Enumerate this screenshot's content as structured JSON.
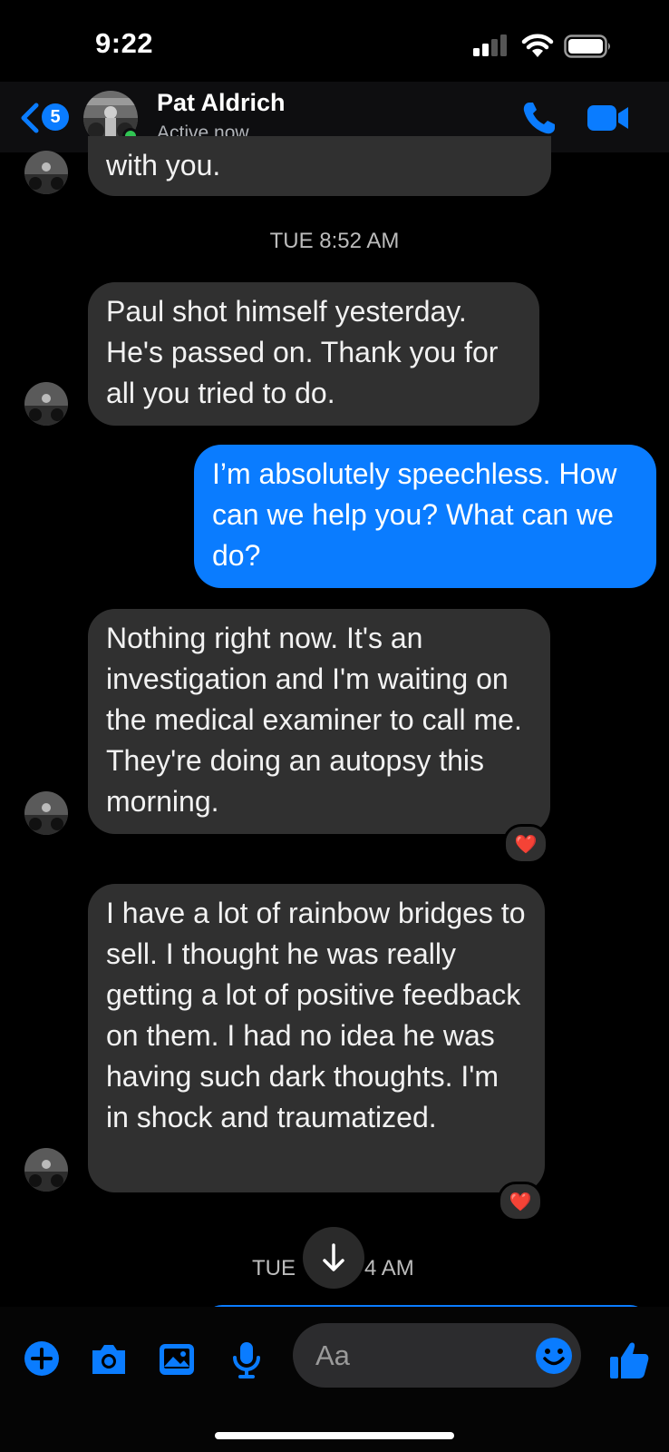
{
  "status_bar": {
    "time": "9:22"
  },
  "header": {
    "back_badge_count": "5",
    "contact_name": "Pat Aldrich",
    "contact_status": "Active now",
    "accent_color": "#0a7cff"
  },
  "chat": {
    "partial_message_tail": "with you.",
    "timestamp_1": "TUE 8:52 AM",
    "msg_1": "Paul shot himself yesterday. He's passed on. Thank you for all you tried to do.",
    "msg_2": "I’m absolutely speechless. How can we help you? What can we do?",
    "msg_3": "Nothing right now. It's an investigation and I'm waiting on the medical examiner to call me. They're doing an autopsy this morning.",
    "msg_3_reaction": "❤️",
    "msg_4": "I have a lot of rainbow bridges to sell. I thought he was really getting a lot of positive feedback on them. I had no idea he was having such dark thoughts. I'm in shock and traumatized.",
    "msg_4_reaction": "❤️",
    "timestamp_2_left": "TUE",
    "timestamp_2_right": "4 AM"
  },
  "composer": {
    "placeholder": "Aa",
    "icons": [
      "plus-icon",
      "camera-icon",
      "image-icon",
      "microphone-icon",
      "emoji-icon",
      "thumbs-up-icon"
    ]
  }
}
